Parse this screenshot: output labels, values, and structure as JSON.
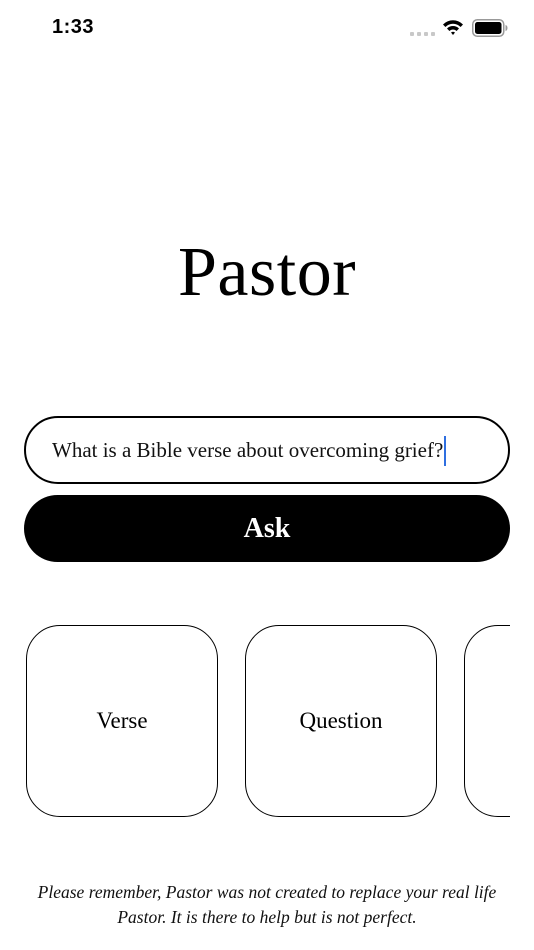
{
  "status_bar": {
    "time": "1:33",
    "icons": [
      "cellular-signal-icon",
      "wifi-icon",
      "battery-icon"
    ]
  },
  "app": {
    "title": "Pastor"
  },
  "question_input": {
    "value": "What is a Bible verse about overcoming grief?",
    "cursor_color": "#2f6fe0"
  },
  "ask_button": {
    "label": "Ask"
  },
  "cards": [
    {
      "label": "Verse"
    },
    {
      "label": "Question"
    },
    {
      "label": ""
    }
  ],
  "disclaimer": {
    "line1": "Please remember, Pastor was not created to replace your real life",
    "line2": "Pastor. It is there to help but is not perfect."
  },
  "colors": {
    "background": "#ffffff",
    "primary": "#000000",
    "accent_cursor": "#2f6fe0"
  }
}
